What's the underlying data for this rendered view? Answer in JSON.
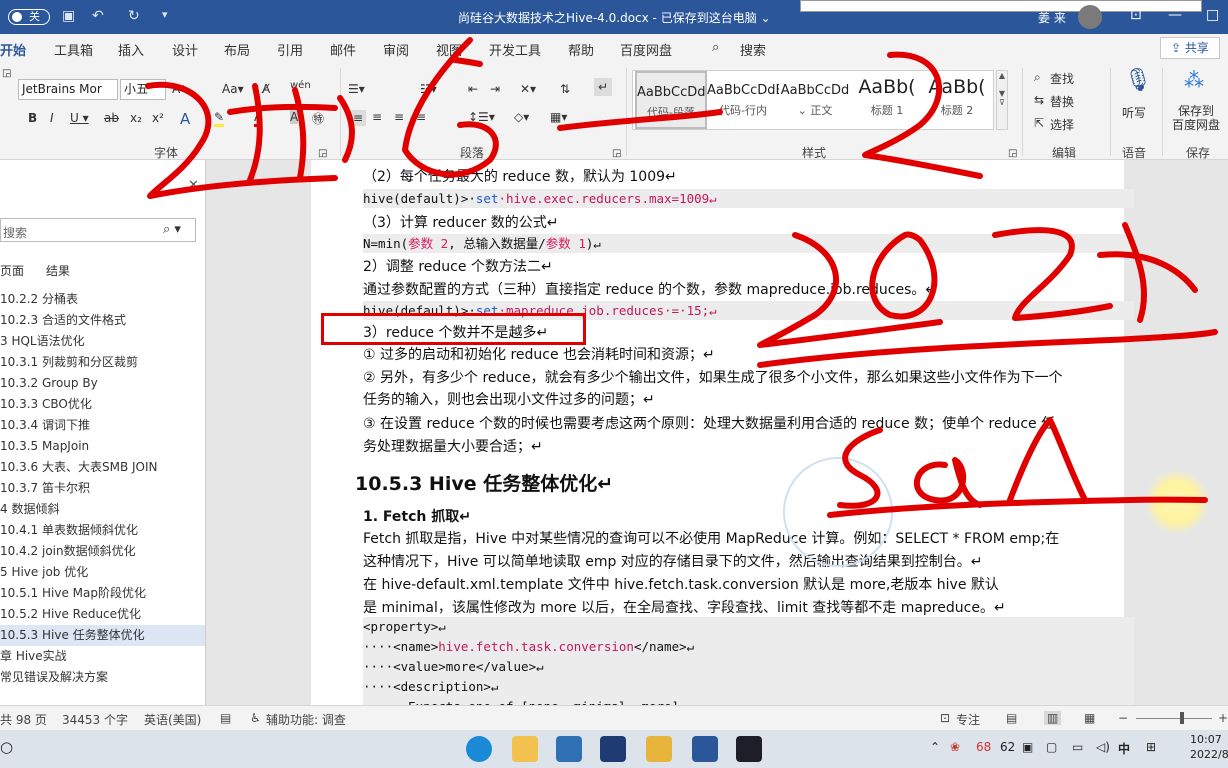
{
  "titlebar": {
    "autosave_label": "关",
    "doc_title": "尚硅谷大数据技术之Hive-4.0.docx - 已保存到这台电脑 ⌄",
    "user": "姜 来",
    "search_value": ""
  },
  "tabs": [
    "开始",
    "工具箱",
    "插入",
    "设计",
    "布局",
    "引用",
    "邮件",
    "审阅",
    "视图",
    "开发工具",
    "帮助",
    "百度网盘",
    "搜索"
  ],
  "share_label": "共享",
  "ribbon": {
    "font_name": "JetBrains Mor",
    "font_size": "小五",
    "group_font": "字体",
    "group_paragraph": "段落",
    "group_styles": "样式",
    "group_edit": "编辑",
    "group_voice": "语音",
    "group_save": "保存",
    "styles": [
      {
        "preview": "AaBbCcDdE",
        "name": "代码-段落"
      },
      {
        "preview": "AaBbCcDdE",
        "name": "代码-行内"
      },
      {
        "preview": "AaBbCcDd",
        "name": "⌄ 正文"
      },
      {
        "preview": "AaBb(",
        "name": "标题 1"
      },
      {
        "preview": "AaBb(",
        "name": "标题 2"
      }
    ],
    "find": "查找",
    "replace": "替换",
    "select": "选择",
    "dictate": "听写",
    "save_to": "保存到\n百度网盘"
  },
  "nav": {
    "search_placeholder": "搜索",
    "tab_pages": "页面",
    "tab_results": "结果",
    "items": [
      "10.2.2 分桶表",
      "10.2.3 合适的文件格式",
      "3 HQL语法优化",
      "10.3.1 列裁剪和分区裁剪",
      "10.3.2 Group By",
      "10.3.3 CBO优化",
      "10.3.4 谓词下推",
      "10.3.5 MapJoin",
      "10.3.6 大表、大表SMB JOIN",
      "10.3.7 笛卡尔积",
      "4 数据倾斜",
      "10.4.1 单表数据倾斜优化",
      "10.4.2 join数据倾斜优化",
      "5 Hive job 优化",
      "10.5.1 Hive Map阶段优化",
      "10.5.2 Hive Reduce优化",
      "10.5.3 Hive 任务整体优化",
      "章 Hive实战",
      "常见错误及解决方案"
    ]
  },
  "doc": {
    "l1": "（2）每个任务最大的 reduce 数，默认为 1009↵",
    "c1_prompt": "hive(default)>·",
    "c1_kw": "set",
    "c1_rest": "·hive.exec.reducers.max=1009↵",
    "l2": "（3）计算 reducer 数的公式↵",
    "c2_a": "N=min(",
    "c2_p2": "参数 2",
    "c2_b": ", 总输入数据量/",
    "c2_p1": "参数 1",
    "c2_c": ")↵",
    "l3": "2）调整 reduce 个数方法二↵",
    "l4": "通过参数配置的方式（三种）直接指定 reduce 的个数，参数 mapreduce.job.reduces。↵",
    "c3_prompt": "hive(default)>·",
    "c3_kw": "set",
    "c3_rest": "·mapreduce.job.reduces·=·15;↵",
    "l5": "3）reduce 个数并不是越多↵",
    "l6": "① 过多的启动和初始化 reduce 也会消耗时间和资源；↵",
    "l7": "② 另外，有多少个 reduce，就会有多少个输出文件，如果生成了很多个小文件，那么如果这些小文件作为下一个",
    "l8": "任务的输入，则也会出现小文件过多的问题；↵",
    "l9": "③ 在设置 reduce 个数的时候也需要考虑这两个原则：处理大数据量利用合适的 reduce 数；使单个 reduce 任",
    "l10": "务处理数据量大小要合适；↵",
    "h1": "10.5.3 Hive 任务整体优化↵",
    "h2": "1. Fetch 抓取↵",
    "p1": "Fetch 抓取是指，Hive 中对某些情况的查询可以不必使用 MapReduce 计算。例如：SELECT * FROM emp;在",
    "p2": "这种情况下，Hive 可以简单地读取 emp 对应的存储目录下的文件，然后输出查询结果到控制台。↵",
    "p3": "在 hive-default.xml.template 文件中 hive.fetch.task.conversion 默认是 more,老版本 hive 默认",
    "p4": "是 minimal，该属性修改为 more 以后，在全局查找、字段查找、limit 查找等都不走 mapreduce。↵",
    "x1": "<property>↵",
    "x2a": "····<name>",
    "x2b": "hive.fetch.task.conversion",
    "x2c": "</name>↵",
    "x3": "····<value>more</value>↵",
    "x4": "····<description>↵",
    "x5": "······Expects one of [none, minimal, more]."
  },
  "status": {
    "pages": "共 98 页",
    "words": "34453 个字",
    "lang": "英语(美国)",
    "access": "辅助功能: 调查",
    "focus": "专注"
  },
  "taskbar": {
    "temp": "68",
    "num": "62",
    "ime": "中",
    "time": "10:07",
    "date": "2022/8/"
  }
}
